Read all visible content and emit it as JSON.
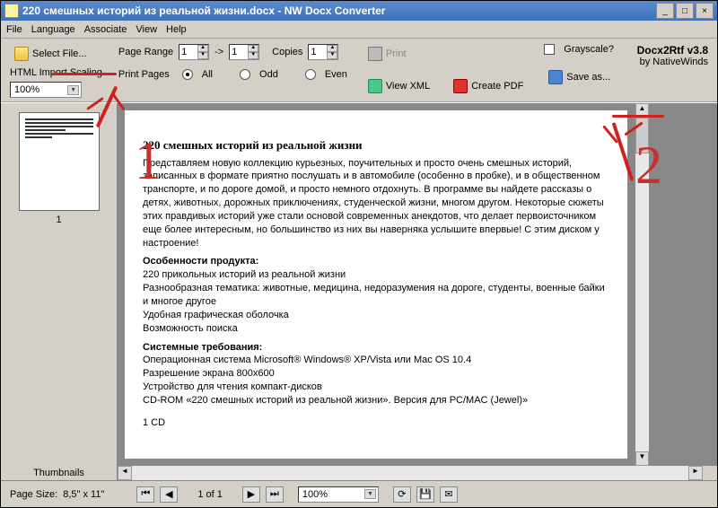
{
  "window": {
    "title": "220 смешных историй из реальной жизни.docx - NW Docx Converter"
  },
  "menu": {
    "file": "File",
    "language": "Language",
    "associate": "Associate",
    "view": "View",
    "help": "Help"
  },
  "toolbar": {
    "select_file": "Select File...",
    "scaling_label": "HTML Import Scaling",
    "scaling_value": "100%",
    "page_range": "Page Range",
    "range_from": "1",
    "range_arrow": "->",
    "range_to": "1",
    "copies": "Copies",
    "copies_val": "1",
    "print_pages": "Print Pages",
    "all": "All",
    "odd": "Odd",
    "even": "Even",
    "print": "Print",
    "grayscale": "Grayscale?",
    "view_xml": "View XML",
    "create_pdf": "Create PDF",
    "save_as": "Save as...",
    "product": "Docx2Rtf v3.8",
    "vendor": "by NativeWinds"
  },
  "thumb": {
    "page_number": "1",
    "section_label": "Thumbnails"
  },
  "status": {
    "page_size_label": "Page Size:",
    "page_size": "8,5\" x 11\"",
    "page_of": "1 of 1",
    "zoom": "100%"
  },
  "doc": {
    "title": "220 смешных историй из реальной жизни",
    "p1": "Представляем новую коллекцию курьезных, поучительных и просто очень смешных историй, записанных в формате приятно послушать и в автомобиле (особенно в пробке), и в общественном транспорте, и по дороге домой, и просто немного отдохнуть. В программе вы найдете рассказы о детях, животных, дорожных приключениях, студенческой жизни, многом другом. Некоторые сюжеты этих правдивых историй уже стали основой современных анекдотов, что делает первоисточником еще более интересным, но большинство из них вы наверняка услышите впервые! С этим диском у настроение!",
    "features_h": "Особенности продукта:",
    "f1": "220 прикольных историй из реальной жизни",
    "f2": "Разнообразная тематика: животные, медицина, недоразумения на дороге, студенты, военные байки и многое другое",
    "f3": "Удобная графическая оболочка",
    "f4": "Возможность поиска",
    "sys_h": "Системные требования:",
    "s1": "Операционная система Microsoft® Windows® XP/Vista или Mac OS 10.4",
    "s2": "Разрешение экрана 800x600",
    "s3": "Устройство для чтения компакт-дисков",
    "s4": "CD-ROM «220 смешных историй из реальной жизни». Версия для PC/MAC (Jewel)»",
    "cd": "1 CD"
  },
  "annotation": {
    "one": "1",
    "two": "2"
  }
}
